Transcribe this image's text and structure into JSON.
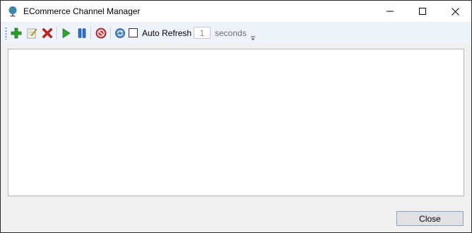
{
  "window": {
    "title": "ECommerce Channel Manager",
    "app_icon": "globe-icon"
  },
  "toolbar": {
    "buttons": [
      {
        "name": "add",
        "icon": "add-icon",
        "color": "#2e9e2e"
      },
      {
        "name": "edit",
        "icon": "edit-icon",
        "color": "#c9a227"
      },
      {
        "name": "delete",
        "icon": "delete-icon",
        "color": "#d42020"
      },
      {
        "name": "start",
        "icon": "play-icon",
        "color": "#2fa52f"
      },
      {
        "name": "pause",
        "icon": "pause-icon",
        "color": "#2a6fc9"
      },
      {
        "name": "stop",
        "icon": "stop-icon",
        "color": "#d63a3a"
      },
      {
        "name": "refresh",
        "icon": "refresh-icon",
        "color": "#2f6fb8"
      }
    ],
    "auto_refresh_label": "Auto Refresh",
    "auto_refresh_checked": false,
    "interval_value": "1",
    "interval_unit": "seconds"
  },
  "footer": {
    "close_label": "Close"
  },
  "colors": {
    "toolbar_bg": "#eef3fa",
    "accent_border": "#7aa7d9"
  }
}
